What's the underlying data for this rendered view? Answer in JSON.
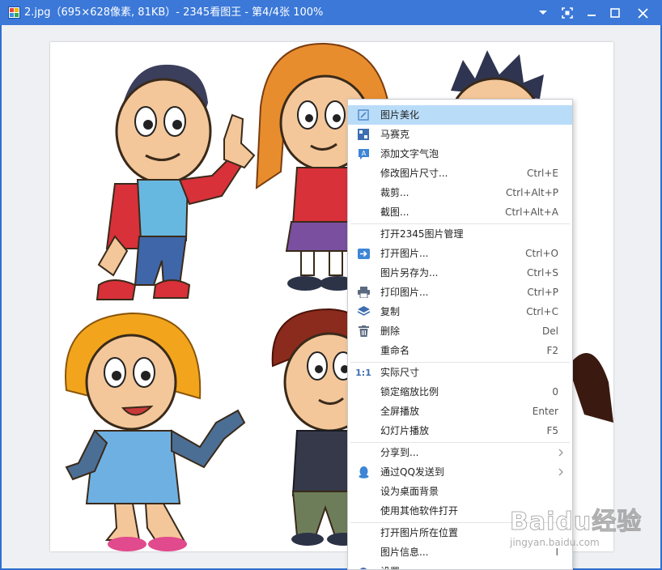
{
  "window": {
    "title": "2.jpg（695×628像素, 81KB）- 2345看图王 - 第4/4张 100%",
    "controls": [
      "dropdown-icon",
      "fit-screen-icon",
      "minimize-icon",
      "maximize-icon",
      "close-icon"
    ]
  },
  "image": {
    "subject": "cartoon kids illustration",
    "colors": {
      "frame": "#3b78d8",
      "menu_highlight": "#b9dcf9",
      "icon_blue": "#4a86c8"
    }
  },
  "context_menu": {
    "groups": [
      [
        {
          "label": "图片美化",
          "shortcut": "",
          "icon": "edit-icon",
          "highlighted": true
        },
        {
          "label": "马赛克",
          "shortcut": "",
          "icon": "mosaic-icon"
        },
        {
          "label": "添加文字气泡",
          "shortcut": "",
          "icon": "text-bubble-icon"
        },
        {
          "label": "修改图片尺寸...",
          "shortcut": "Ctrl+E",
          "icon": ""
        },
        {
          "label": "裁剪...",
          "shortcut": "Ctrl+Alt+P",
          "icon": ""
        },
        {
          "label": "截图...",
          "shortcut": "Ctrl+Alt+A",
          "icon": ""
        }
      ],
      [
        {
          "label": "打开2345图片管理",
          "shortcut": "",
          "icon": ""
        },
        {
          "label": "打开图片...",
          "shortcut": "Ctrl+O",
          "icon": "open-icon"
        },
        {
          "label": "图片另存为...",
          "shortcut": "Ctrl+S",
          "icon": ""
        },
        {
          "label": "打印图片...",
          "shortcut": "Ctrl+P",
          "icon": "print-icon"
        },
        {
          "label": "复制",
          "shortcut": "Ctrl+C",
          "icon": "copy-icon"
        },
        {
          "label": "删除",
          "shortcut": "Del",
          "icon": "trash-icon"
        },
        {
          "label": "重命名",
          "shortcut": "F2",
          "icon": ""
        }
      ],
      [
        {
          "label": "实际尺寸",
          "shortcut": "",
          "icon": "actual-size-icon"
        },
        {
          "label": "锁定缩放比例",
          "shortcut": "0",
          "icon": ""
        },
        {
          "label": "全屏播放",
          "shortcut": "Enter",
          "icon": ""
        },
        {
          "label": "幻灯片播放",
          "shortcut": "F5",
          "icon": ""
        }
      ],
      [
        {
          "label": "分享到...",
          "shortcut": "",
          "icon": "",
          "submenu": true
        },
        {
          "label": "通过QQ发送到",
          "shortcut": "",
          "icon": "qq-icon",
          "submenu": true
        },
        {
          "label": "设为桌面背景",
          "shortcut": "",
          "icon": ""
        },
        {
          "label": "使用其他软件打开",
          "shortcut": "",
          "icon": ""
        }
      ],
      [
        {
          "label": "打开图片所在位置",
          "shortcut": "",
          "icon": ""
        },
        {
          "label": "图片信息...",
          "shortcut": "I",
          "icon": ""
        },
        {
          "label": "设置",
          "shortcut": "",
          "icon": "settings-icon"
        }
      ]
    ]
  },
  "watermark": {
    "main": "Baidu经验",
    "sub": "jingyan.baidu.com"
  }
}
